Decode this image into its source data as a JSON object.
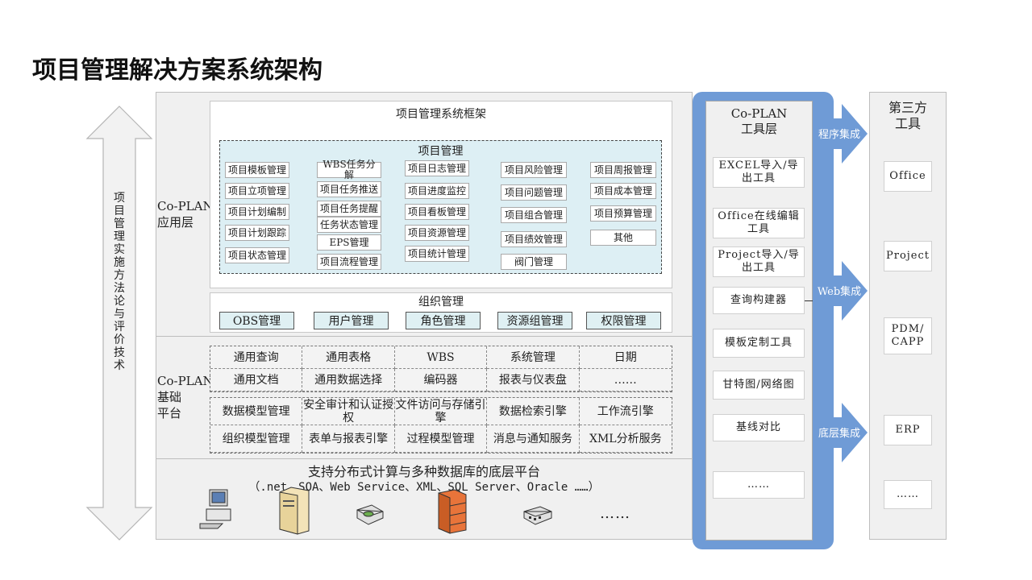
{
  "title": "项目管理解决方案系统架构",
  "left_arrow_text": "项目管理实施方法论与评价技术",
  "layers": {
    "app": "Co-PLAN\n应用层",
    "base": "Co-PLAN\n基础\n平台"
  },
  "framework": {
    "title": "项目管理系统框架",
    "pm_title": "项目管理",
    "columns": [
      [
        "项目模板管理",
        "项目立项管理",
        "项目计划编制",
        "项目计划跟踪",
        "项目状态管理"
      ],
      [
        "WBS任务分解",
        "项目任务推送",
        "项目任务提醒",
        "任务状态管理",
        "EPS管理",
        "项目流程管理"
      ],
      [
        "项目日志管理",
        "项目进度监控",
        "项目看板管理",
        "项目资源管理",
        "项目统计管理"
      ],
      [
        "项目风险管理",
        "项目问题管理",
        "项目组合管理",
        "项目绩效管理",
        "阀门管理"
      ],
      [
        "项目周报管理",
        "项目成本管理",
        "项目预算管理",
        "其他"
      ]
    ]
  },
  "org": {
    "title": "组织管理",
    "items": [
      "OBS管理",
      "用户管理",
      "角色管理",
      "资源组管理",
      "权限管理"
    ]
  },
  "base_grid1": [
    "通用查询",
    "通用表格",
    "WBS",
    "系统管理",
    "日期",
    "通用文档",
    "通用数据选择",
    "编码器",
    "报表与仪表盘",
    "……"
  ],
  "base_grid2": [
    "数据模型管理",
    "安全审计和认证授权",
    "文件访问与存储引擎",
    "数据检索引擎",
    "工作流引擎",
    "组织模型管理",
    "表单与报表引擎",
    "过程模型管理",
    "消息与通知服务",
    "XML分析服务"
  ],
  "platform": {
    "line1": "支持分布式计算与多种数据库的底层平台",
    "line2": "（.net、SOA、Web Service、XML、SQL Server、Oracle ……）",
    "more": "……"
  },
  "tools": {
    "title": "Co-PLAN\n工具层",
    "items": [
      "EXCEL导入/导出工具",
      "Office在线编辑工具",
      "Project导入/导出工具",
      "查询构建器",
      "模板定制工具",
      "甘特图/网络图",
      "基线对比",
      "……"
    ]
  },
  "arrows": [
    "程序集成",
    "Web集成",
    "底层集成"
  ],
  "third": {
    "title": "第三方\n工具",
    "items": [
      "Office",
      "Project",
      "PDM/\nCAPP",
      "ERP",
      "……"
    ]
  },
  "colors": {
    "accent": "#6f9bd6",
    "pm_bg": "#ddeff4",
    "panel": "#f0f0f0"
  },
  "icons": [
    "computer-icon",
    "server-icon",
    "router-icon",
    "firewall-icon",
    "switch-icon"
  ]
}
